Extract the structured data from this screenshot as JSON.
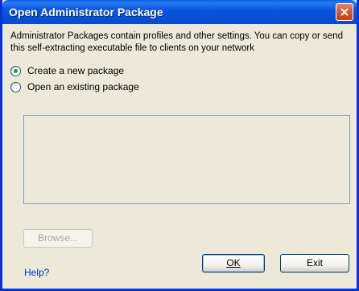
{
  "window": {
    "title": "Open Administrator Package"
  },
  "description": "Administrator Packages contain profiles and other settings. You can copy or send this self-extracting executable file to clients on your network",
  "options": [
    {
      "label": "Create a new package",
      "checked": true
    },
    {
      "label": "Open an existing package",
      "checked": false
    }
  ],
  "buttons": {
    "browse": "Browse...",
    "ok": "OK",
    "exit": "Exit"
  },
  "help": {
    "label": "Help?"
  },
  "colors": {
    "title_bar": "#0855dd",
    "close_button": "#d9562f",
    "dialog_bg": "#ece9d8",
    "link": "#0033cc"
  }
}
